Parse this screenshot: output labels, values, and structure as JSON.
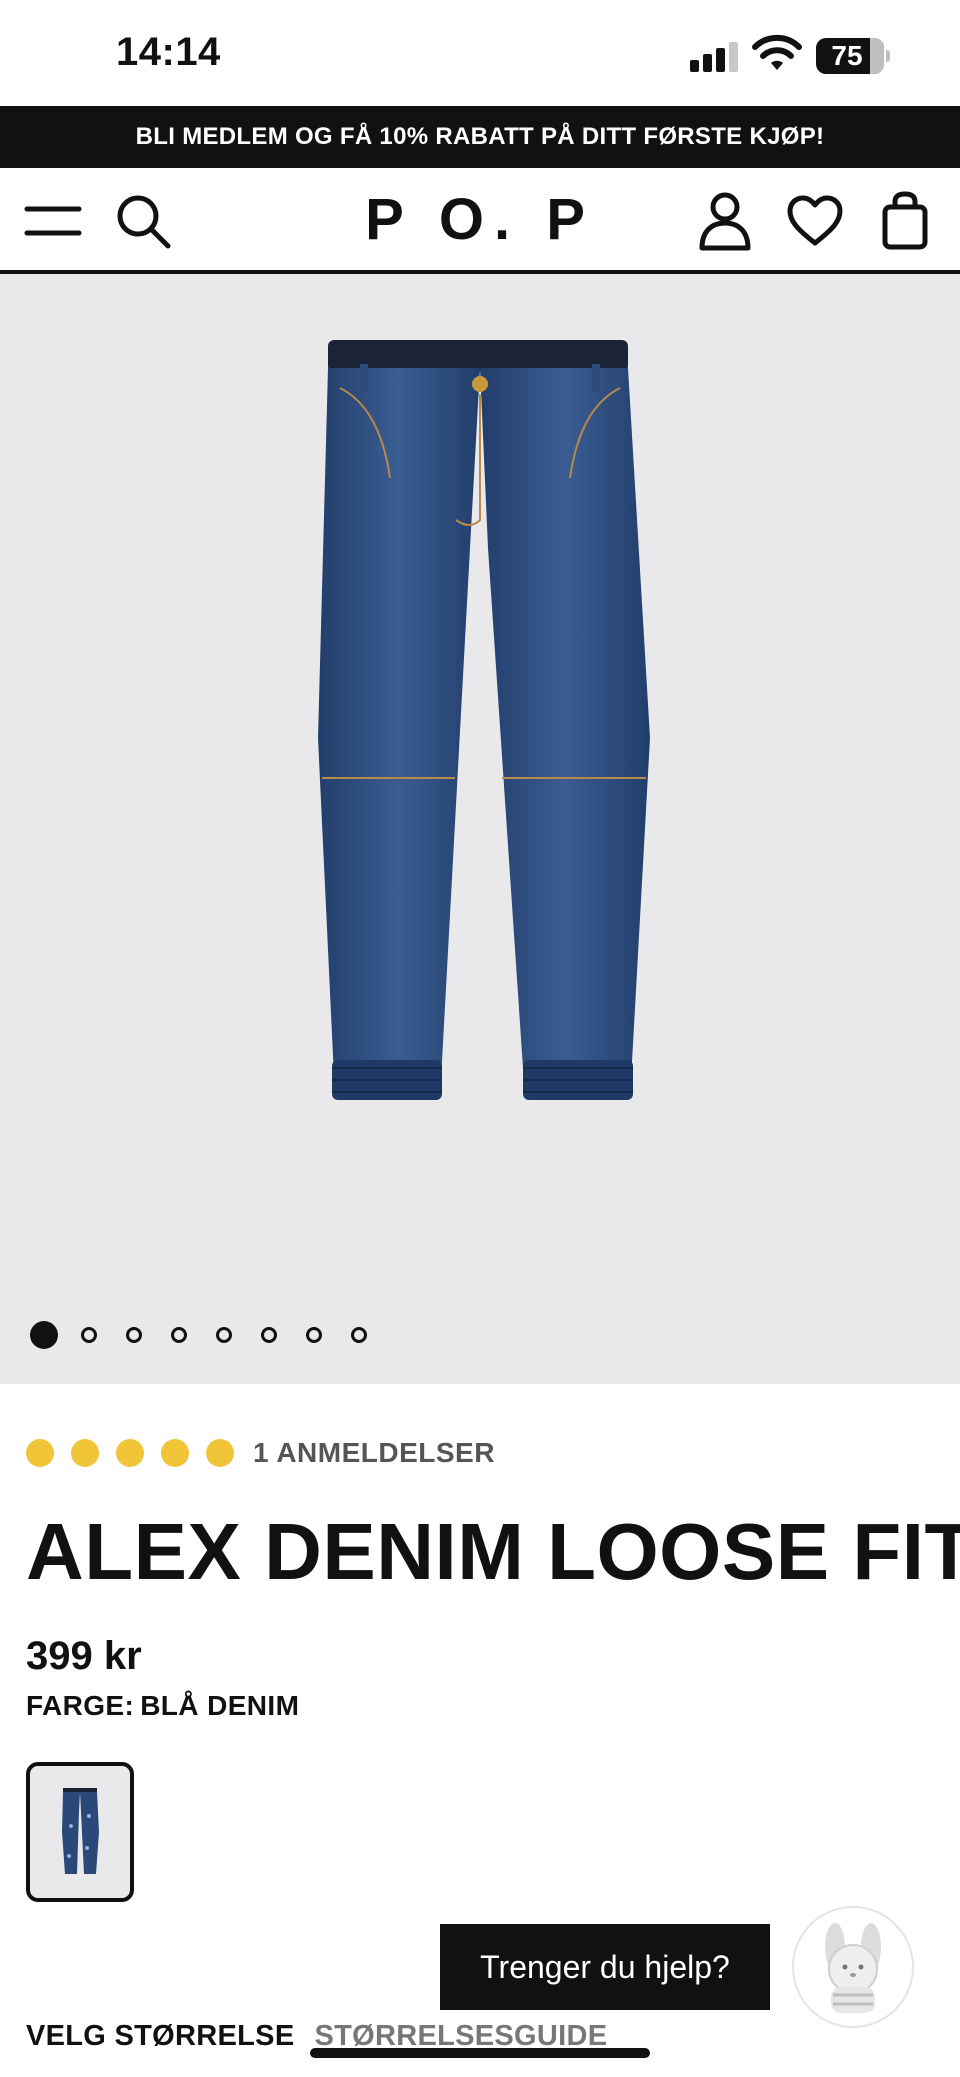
{
  "status_bar": {
    "time": "14:14",
    "battery_percent": "75",
    "icons": [
      "signal-icon",
      "wifi-icon",
      "battery-icon"
    ]
  },
  "promo": {
    "text": "BLI MEDLEM OG FÅ 10% RABATT PÅ DITT FØRSTE KJØP!"
  },
  "header": {
    "logo": "P O. P",
    "icons": [
      "menu-icon",
      "search-icon",
      "account-icon",
      "heart-icon",
      "bag-icon"
    ]
  },
  "gallery": {
    "image": "blue-denim-jogger-pants",
    "total_images": 8,
    "active_index": 0
  },
  "product": {
    "rating": 5,
    "rating_max": 5,
    "reviews_label": "1 ANMELDELSER",
    "title": "ALEX DENIM LOOSE FIT",
    "price": "399 kr",
    "color_label": "FARGE:",
    "color_value": "BLÅ DENIM"
  },
  "size": {
    "select_label": "VELG STØRRELSE",
    "guide_label": "STØRRELSESGUIDE"
  },
  "help": {
    "button_label": "Trenger du hjelp?"
  },
  "colors": {
    "star": "#f0c537",
    "banner": "#111111",
    "denim": "#2a4878"
  }
}
